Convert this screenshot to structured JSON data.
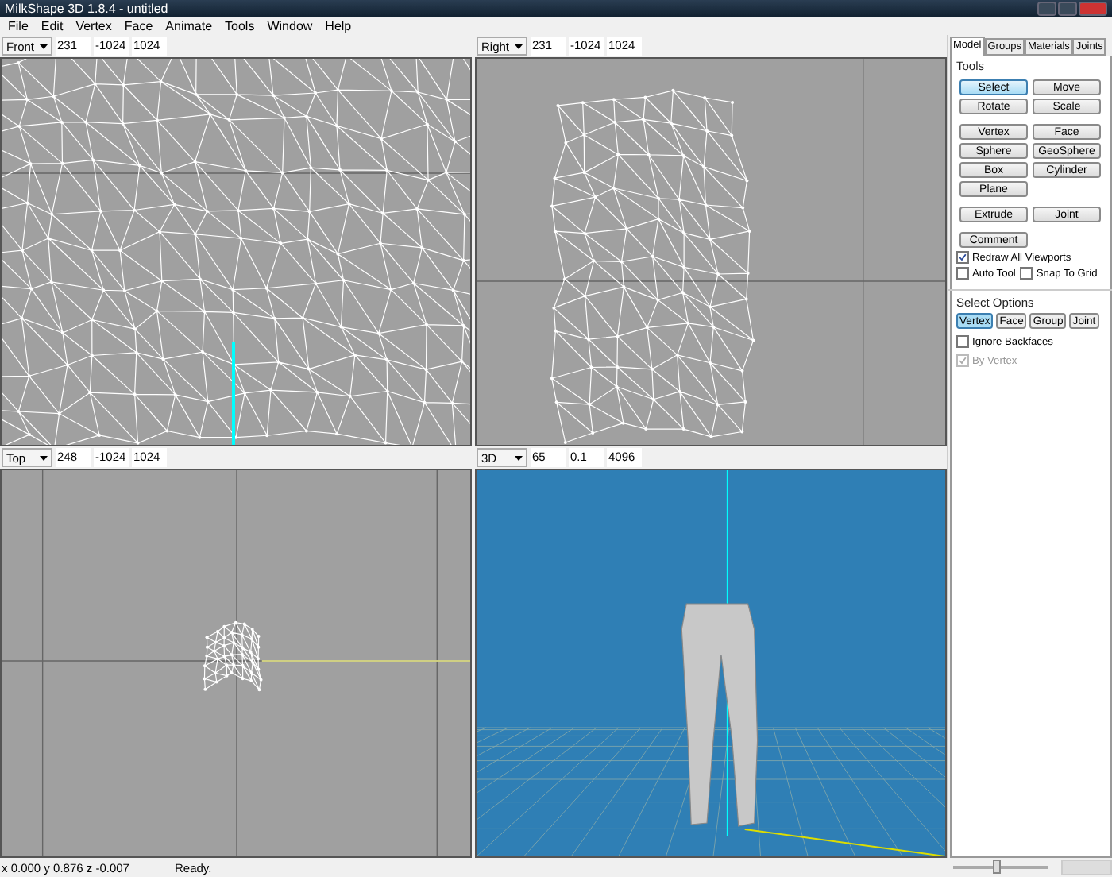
{
  "window": {
    "title": "MilkShape 3D 1.8.4 - untitled"
  },
  "menu": [
    "File",
    "Edit",
    "Vertex",
    "Face",
    "Animate",
    "Tools",
    "Window",
    "Help"
  ],
  "viewports": [
    {
      "view": "Front",
      "values": [
        "231",
        "-1024",
        "1024"
      ],
      "kind": "front"
    },
    {
      "view": "Right",
      "values": [
        "231",
        "-1024",
        "1024"
      ],
      "kind": "side"
    },
    {
      "view": "Top",
      "values": [
        "248",
        "-1024",
        "1024"
      ],
      "kind": "top"
    },
    {
      "view": "3D",
      "values": [
        "65",
        "0.1",
        "4096"
      ],
      "kind": "shaded"
    }
  ],
  "panel": {
    "tabs": [
      {
        "label": "Model",
        "selected": true
      },
      {
        "label": "Groups",
        "selected": false
      },
      {
        "label": "Materials",
        "selected": false
      },
      {
        "label": "Joints",
        "selected": false
      }
    ],
    "tools_label": "Tools",
    "tool_groups": [
      [
        {
          "label": "Select",
          "selected": true
        },
        {
          "label": "Move",
          "selected": false
        },
        {
          "label": "Rotate",
          "selected": false
        },
        {
          "label": "Scale",
          "selected": false
        }
      ],
      [
        {
          "label": "Vertex",
          "selected": false
        },
        {
          "label": "Face",
          "selected": false
        },
        {
          "label": "Sphere",
          "selected": false
        },
        {
          "label": "GeoSphere",
          "selected": false
        },
        {
          "label": "Box",
          "selected": false
        },
        {
          "label": "Cylinder",
          "selected": false
        },
        {
          "label": "Plane",
          "selected": false
        }
      ],
      [
        {
          "label": "Extrude",
          "selected": false
        },
        {
          "label": "Joint",
          "selected": false
        }
      ],
      [
        {
          "label": "Comment",
          "selected": false
        }
      ]
    ],
    "view_options": [
      {
        "label": "Redraw All Viewports",
        "checked": true
      },
      {
        "label": "Auto Tool",
        "checked": false
      },
      {
        "label": "Snap To Grid",
        "checked": false
      }
    ],
    "select_label": "Select Options",
    "select_modes": [
      {
        "label": "Vertex",
        "selected": true
      },
      {
        "label": "Face",
        "selected": false
      },
      {
        "label": "Group",
        "selected": false
      },
      {
        "label": "Joint",
        "selected": false
      }
    ],
    "select_options": [
      {
        "label": "Ignore Backfaces",
        "checked": false,
        "disabled": false
      },
      {
        "label": "By Vertex",
        "checked": true,
        "disabled": true
      }
    ]
  },
  "status_bar": {
    "coords": "x 0.000 y 0.876 z -0.007",
    "message": "Ready.",
    "zoom": {
      "level": 0.45
    }
  }
}
